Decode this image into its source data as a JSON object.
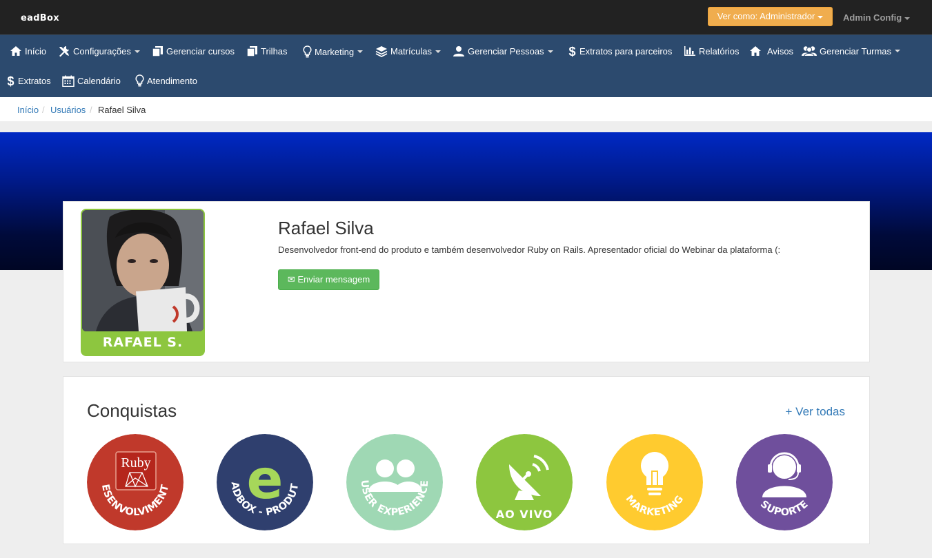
{
  "topbar": {
    "logo": "eadBox",
    "view_as": "Ver como: Administrador",
    "admin_config": "Admin Config"
  },
  "nav": {
    "items": [
      {
        "label": "Início",
        "icon": "home-icon"
      },
      {
        "label": "Configurações",
        "icon": "wrench-icon",
        "dropdown": true
      },
      {
        "label": "Gerenciar cursos",
        "icon": "copy-icon"
      },
      {
        "label": "Trilhas",
        "icon": "copy-icon"
      },
      {
        "label": "Marketing",
        "icon": "lightbulb-icon",
        "dropdown": true
      },
      {
        "label": "Matrículas",
        "icon": "layers-icon",
        "dropdown": true
      },
      {
        "label": "Gerenciar Pessoas",
        "icon": "user-icon",
        "dropdown": true
      },
      {
        "label": "Extratos para parceiros",
        "icon": "dollar-icon"
      },
      {
        "label": "Relatórios",
        "icon": "bar-chart-icon"
      },
      {
        "label": "Avisos",
        "icon": "home-icon"
      },
      {
        "label": "Gerenciar Turmas",
        "icon": "group-icon",
        "dropdown": true
      },
      {
        "label": "Extratos",
        "icon": "dollar-icon"
      },
      {
        "label": "Calendário",
        "icon": "calendar-icon"
      },
      {
        "label": "Atendimento",
        "icon": "lightbulb-icon"
      }
    ]
  },
  "breadcrumb": {
    "items": [
      "Início",
      "Usuários",
      "Rafael Silva"
    ]
  },
  "profile": {
    "name": "Rafael Silva",
    "avatar_label": "RAFAEL S.",
    "description": "Desenvolvedor front-end do produto e também desenvolvedor Ruby on Rails. Apresentador oficial do Webinar da plataforma (:",
    "message_button": "Enviar mensagem",
    "message_icon": "envelope-icon"
  },
  "achievements": {
    "title": "Conquistas",
    "see_all": "+ Ver todas",
    "badges": [
      {
        "label": "DESENVOLVIMENTO",
        "sublabel": "Ruby",
        "color": "#c0392b"
      },
      {
        "label": "EADBOX - PRODUTO",
        "sublabel": "e",
        "color": "#2f3f6e"
      },
      {
        "label": "USER EXPERIENCE",
        "color": "#9fd8b4"
      },
      {
        "label": "AO VIVO",
        "color": "#8dc63f"
      },
      {
        "label": "MARKETING",
        "color": "#ffcb2f"
      },
      {
        "label": "SUPORTE",
        "color": "#6f4f9c"
      }
    ]
  }
}
